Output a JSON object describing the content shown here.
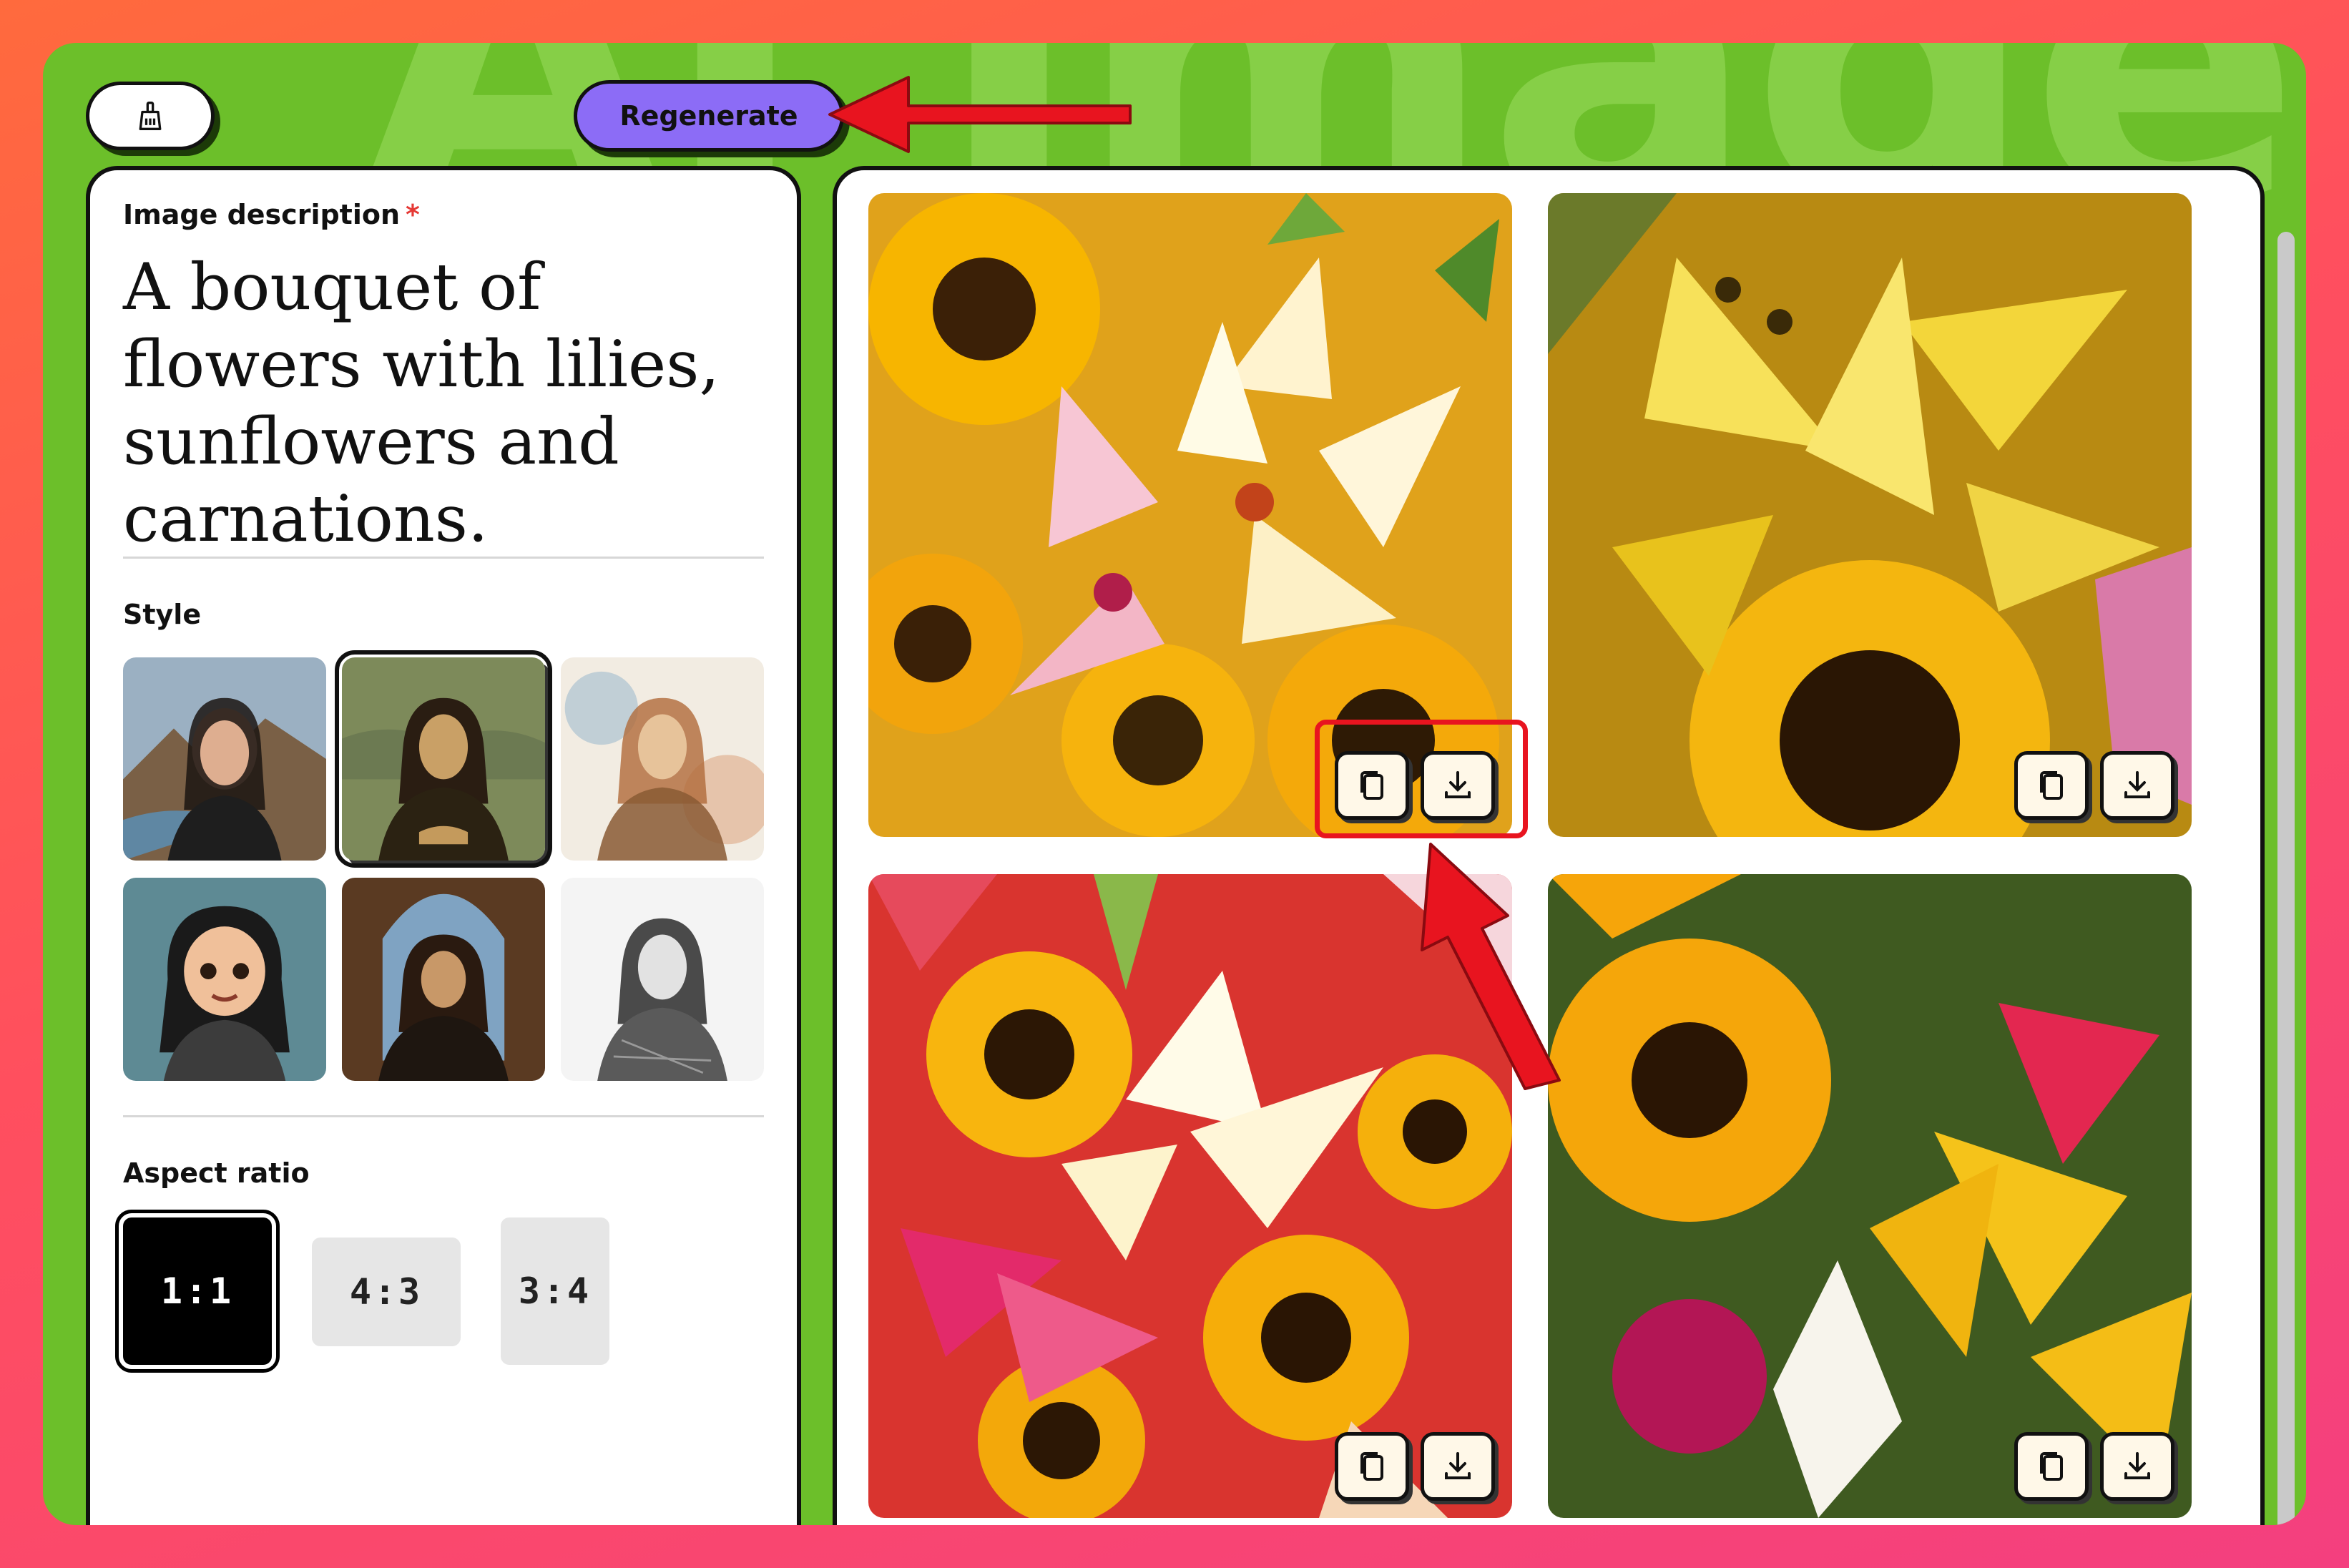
{
  "app": {
    "background_word": "AI Image",
    "clear_icon": "broom-icon",
    "regenerate_label": "Regenerate"
  },
  "form": {
    "description_label": "Image description",
    "required_mark": "*",
    "description_value": "A bouquet of flowers with lilies, sunflowers and carnations.",
    "style_label": "Style",
    "styles": [
      {
        "name": "photographic",
        "selected": false
      },
      {
        "name": "oil-painting",
        "selected": true
      },
      {
        "name": "watercolor",
        "selected": false
      },
      {
        "name": "cartoon",
        "selected": false
      },
      {
        "name": "renaissance",
        "selected": false
      },
      {
        "name": "pencil-sketch",
        "selected": false
      }
    ],
    "aspect_label": "Aspect ratio",
    "aspect_options": [
      "1:1",
      "4:3",
      "3:4"
    ],
    "aspect_selected": "1:1"
  },
  "results": {
    "icons": [
      "copy-icon",
      "download-icon"
    ],
    "count": 4
  },
  "colors": {
    "app_green": "#6cbf2a",
    "accent_purple": "#8c6cf6",
    "annotation_red": "#e8141f"
  }
}
